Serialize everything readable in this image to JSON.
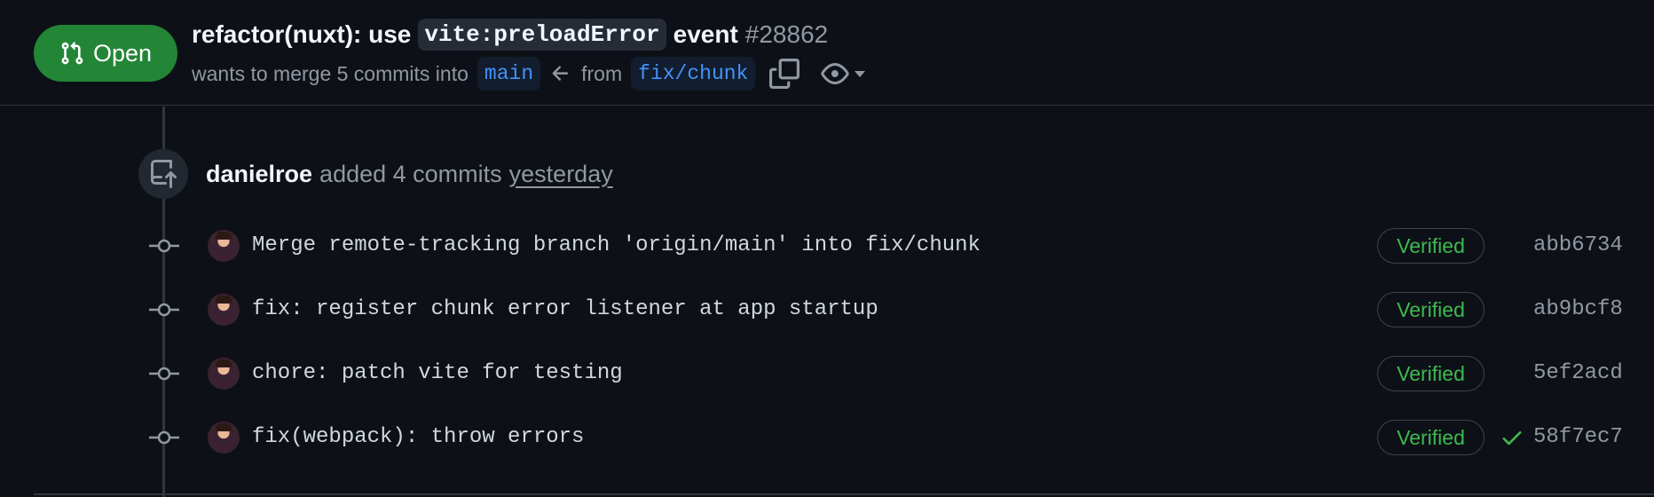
{
  "pr": {
    "status": "Open",
    "title_prefix": "refactor(nuxt): use",
    "title_code": "vite:preloadError",
    "title_suffix": "event",
    "number": "#28862",
    "merge_text": "wants to merge 5 commits into",
    "base_branch": "main",
    "from_text": "from",
    "head_branch": "fix/chunk"
  },
  "colors": {
    "open_badge": "#238636",
    "verified": "#3fb950",
    "branch_link": "#4493f8",
    "background": "#0d1117"
  },
  "event": {
    "user": "danielroe",
    "action": "added 4 commits",
    "time": "yesterday",
    "icon": "repo-push-icon"
  },
  "commits": [
    {
      "message": "Merge remote-tracking branch 'origin/main' into fix/chunk",
      "badge": "Verified",
      "sha": "abb6734",
      "checks_passed": false
    },
    {
      "message": "fix: register chunk error listener at app startup",
      "badge": "Verified",
      "sha": "ab9bcf8",
      "checks_passed": false
    },
    {
      "message": "chore: patch vite for testing",
      "badge": "Verified",
      "sha": "5ef2acd",
      "checks_passed": false
    },
    {
      "message": "fix(webpack): throw errors",
      "badge": "Verified",
      "sha": "58f7ec7",
      "checks_passed": true
    }
  ]
}
